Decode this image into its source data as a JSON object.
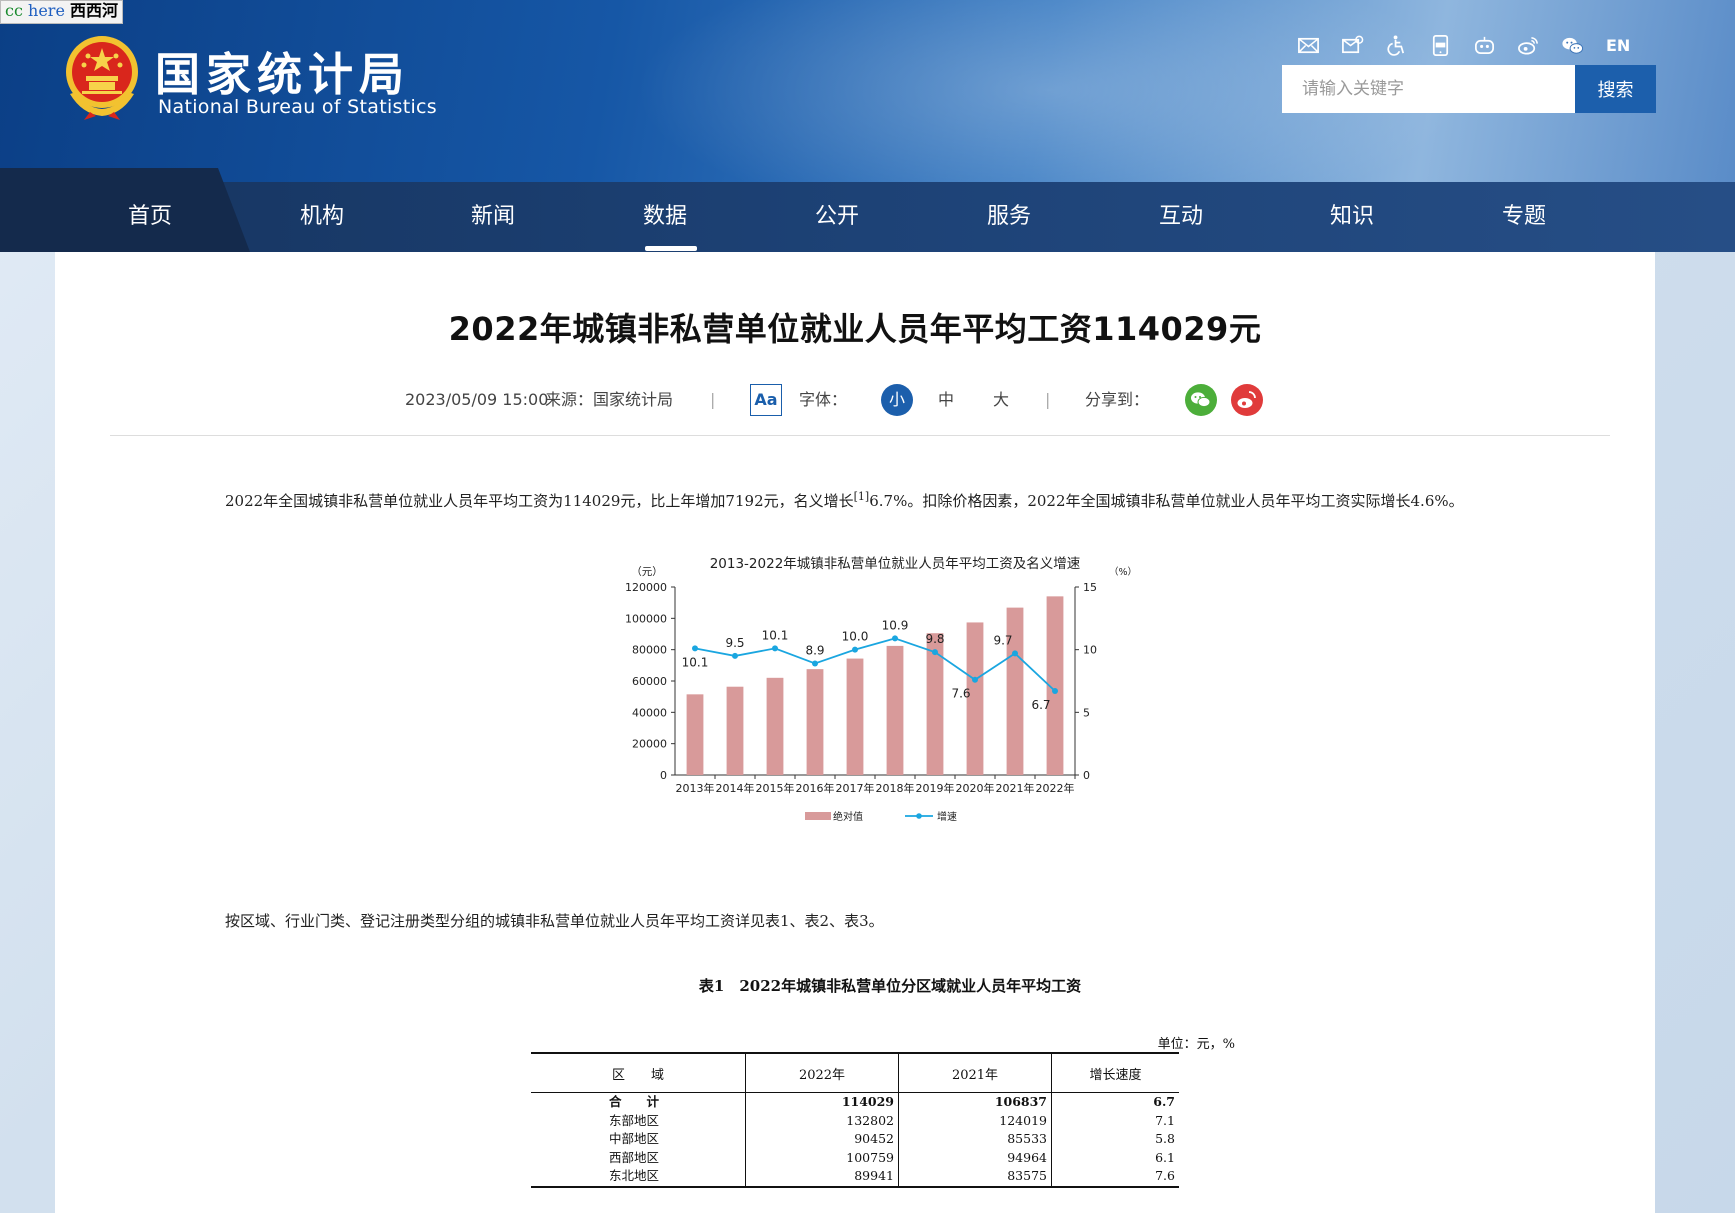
{
  "overlay": {
    "cc": "cc",
    "here": "here",
    "name": "西西河"
  },
  "site": {
    "name_cn": "国家统计局",
    "name_en": "National Bureau of Statistics"
  },
  "tools": {
    "icons": [
      "mail-icon",
      "mail-settings-icon",
      "accessibility-icon",
      "app-icon",
      "robot-icon",
      "weibo-icon",
      "wechat-icon"
    ],
    "lang": "EN"
  },
  "search": {
    "placeholder": "请输入关键字",
    "button": "搜索"
  },
  "nav": {
    "items": [
      "首页",
      "机构",
      "新闻",
      "数据",
      "公开",
      "服务",
      "互动",
      "知识",
      "专题"
    ],
    "active": "数据"
  },
  "article": {
    "title": "2022年城镇非私营单位就业人员年平均工资114029元",
    "date": "2023/05/09 15:00",
    "source": "来源：国家统计局",
    "font_label": "字体：",
    "font_icon": "Aa",
    "font_sizes": [
      "小",
      "中",
      "大"
    ],
    "share_label": "分享到：",
    "p1_before": "2022年全国城镇非私营单位就业人员年平均工资为114029元，比上年增加7192元，名义增长",
    "p1_note": "[1]",
    "p1_after": "6.7%。扣除价格因素，2022年全国城镇非私营单位就业人员年平均工资实际增长4.6%。",
    "p2": "按区域、行业门类、登记注册类型分组的城镇非私营单位就业人员年平均工资详见表1、表2、表3。"
  },
  "chart_data": {
    "type": "bar",
    "title": "2013-2022年城镇非私营单位就业人员年平均工资及名义增速",
    "categories": [
      "2013年",
      "2014年",
      "2015年",
      "2016年",
      "2017年",
      "2018年",
      "2019年",
      "2020年",
      "2021年",
      "2022年"
    ],
    "series": [
      {
        "name": "绝对值",
        "type": "bar",
        "axis": "left",
        "color": "#d89a9a",
        "values": [
          51483,
          56360,
          62029,
          67569,
          74318,
          82413,
          90501,
          97379,
          106837,
          114029
        ]
      },
      {
        "name": "增速",
        "type": "line",
        "axis": "right",
        "color": "#1aa6e0",
        "values": [
          10.1,
          9.5,
          10.1,
          8.9,
          10.0,
          10.9,
          9.8,
          7.6,
          9.7,
          6.7
        ]
      }
    ],
    "yleft": {
      "unit": "（元）",
      "ylim": [
        0,
        120000
      ],
      "ticks": [
        "0",
        "20000",
        "40000",
        "60000",
        "80000",
        "100000",
        "120000"
      ]
    },
    "yright": {
      "unit": "（%）",
      "ylim": [
        0,
        15
      ],
      "ticks": [
        "0",
        "5",
        "10",
        "15"
      ]
    },
    "legend": "bottom"
  },
  "table1": {
    "title": "表1　2022年城镇非私营单位分区域就业人员年平均工资",
    "unit": "单位：元，%",
    "headers": [
      "区　　域",
      "2022年",
      "2021年",
      "增长速度"
    ],
    "rows": [
      [
        "合　　计",
        "114029",
        "106837",
        "6.7"
      ],
      [
        "东部地区",
        "132802",
        "124019",
        "7.1"
      ],
      [
        "中部地区",
        "90452",
        "85533",
        "5.8"
      ],
      [
        "西部地区",
        "100759",
        "94964",
        "6.1"
      ],
      [
        "东北地区",
        "89941",
        "83575",
        "7.6"
      ]
    ]
  }
}
